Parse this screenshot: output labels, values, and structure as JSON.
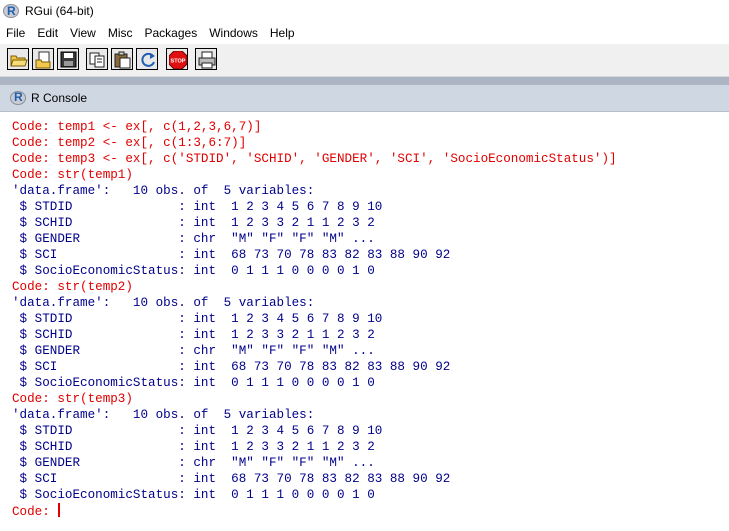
{
  "window": {
    "title": "RGui (64-bit)"
  },
  "menu": [
    "File",
    "Edit",
    "View",
    "Misc",
    "Packages",
    "Windows",
    "Help"
  ],
  "toolbar": [
    {
      "name": "open-script-icon"
    },
    {
      "name": "load-workspace-icon"
    },
    {
      "name": "save-workspace-icon"
    },
    {
      "name": "copy-icon"
    },
    {
      "name": "paste-icon"
    },
    {
      "name": "copy-paste-icon"
    },
    {
      "name": "stop-icon",
      "label": "STOP"
    },
    {
      "name": "print-icon"
    }
  ],
  "console": {
    "title": "R Console",
    "lines": [
      {
        "type": "code",
        "text": "Code: temp1 <- ex[, c(1,2,3,6,7)]"
      },
      {
        "type": "code",
        "text": "Code: temp2 <- ex[, c(1:3,6:7)]"
      },
      {
        "type": "code",
        "text": "Code: temp3 <- ex[, c('STDID', 'SCHID', 'GENDER', 'SCI', 'SocioEconomicStatus')]"
      },
      {
        "type": "code",
        "text": "Code: str(temp1)"
      },
      {
        "type": "out",
        "text": "'data.frame':   10 obs. of  5 variables:"
      },
      {
        "type": "out",
        "text": " $ STDID              : int  1 2 3 4 5 6 7 8 9 10"
      },
      {
        "type": "out",
        "text": " $ SCHID              : int  1 2 3 3 2 1 1 2 3 2"
      },
      {
        "type": "out",
        "text": " $ GENDER             : chr  \"M\" \"F\" \"F\" \"M\" ..."
      },
      {
        "type": "out",
        "text": " $ SCI                : int  68 73 70 78 83 82 83 88 90 92"
      },
      {
        "type": "out",
        "text": " $ SocioEconomicStatus: int  0 1 1 1 0 0 0 0 1 0"
      },
      {
        "type": "code",
        "text": "Code: str(temp2)"
      },
      {
        "type": "out",
        "text": "'data.frame':   10 obs. of  5 variables:"
      },
      {
        "type": "out",
        "text": " $ STDID              : int  1 2 3 4 5 6 7 8 9 10"
      },
      {
        "type": "out",
        "text": " $ SCHID              : int  1 2 3 3 2 1 1 2 3 2"
      },
      {
        "type": "out",
        "text": " $ GENDER             : chr  \"M\" \"F\" \"F\" \"M\" ..."
      },
      {
        "type": "out",
        "text": " $ SCI                : int  68 73 70 78 83 82 83 88 90 92"
      },
      {
        "type": "out",
        "text": " $ SocioEconomicStatus: int  0 1 1 1 0 0 0 0 1 0"
      },
      {
        "type": "code",
        "text": "Code: str(temp3)"
      },
      {
        "type": "out",
        "text": "'data.frame':   10 obs. of  5 variables:"
      },
      {
        "type": "out",
        "text": " $ STDID              : int  1 2 3 4 5 6 7 8 9 10"
      },
      {
        "type": "out",
        "text": " $ SCHID              : int  1 2 3 3 2 1 1 2 3 2"
      },
      {
        "type": "out",
        "text": " $ GENDER             : chr  \"M\" \"F\" \"F\" \"M\" ..."
      },
      {
        "type": "out",
        "text": " $ SCI                : int  68 73 70 78 83 82 83 88 90 92"
      },
      {
        "type": "out",
        "text": " $ SocioEconomicStatus: int  0 1 1 1 0 0 0 0 1 0"
      }
    ],
    "prompt": "Code: "
  }
}
